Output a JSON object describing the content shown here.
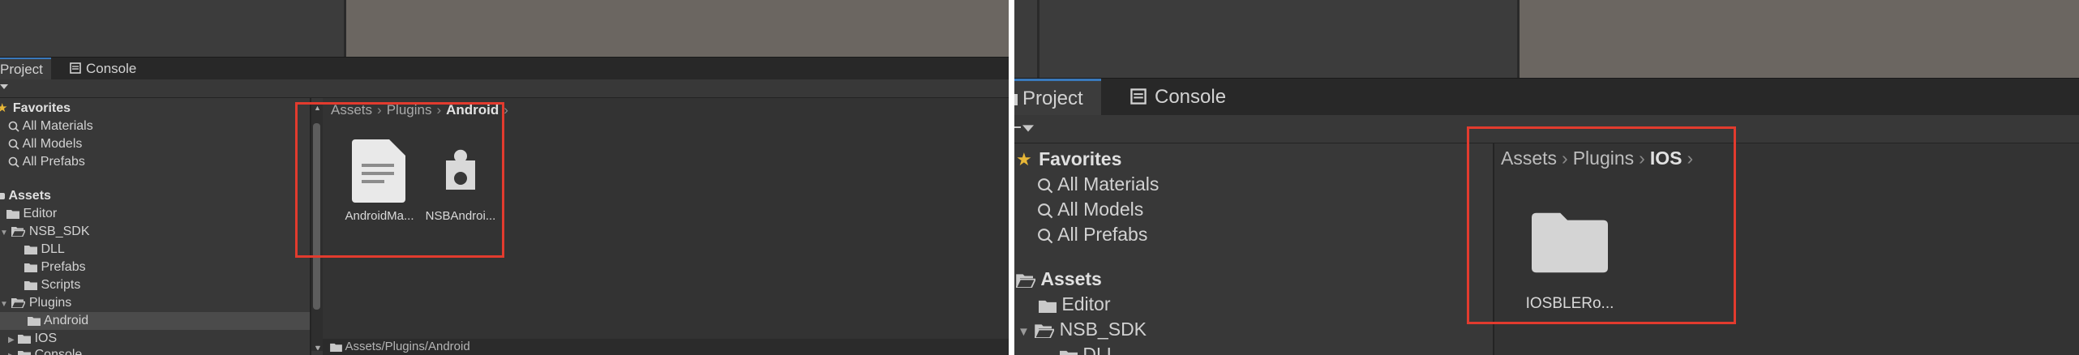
{
  "colors": {
    "highlight_box": "#e23b2e",
    "active_tab_accent": "#3a79bb",
    "panel_bg": "#383838"
  },
  "left": {
    "tabs": [
      {
        "label": "Project",
        "icon": "project-icon"
      },
      {
        "label": "Console",
        "icon": "console-icon"
      }
    ],
    "favorites": {
      "label": "Favorites",
      "items": [
        "All Materials",
        "All Models",
        "All Prefabs"
      ]
    },
    "assets": {
      "label": "Assets",
      "items": [
        "Editor",
        "NSB_SDK",
        "DLL",
        "Prefabs",
        "Scripts",
        "Plugins",
        "Android",
        "IOS",
        "Console"
      ]
    },
    "breadcrumb": [
      "Assets",
      "Plugins",
      "Android"
    ],
    "files": [
      {
        "name": "AndroidMa...",
        "icon": "document-icon"
      },
      {
        "name": "NSBAndroi...",
        "icon": "plugin-icon"
      }
    ],
    "status_path": "Assets/Plugins/Android"
  },
  "right": {
    "tabs": [
      {
        "label": "Project",
        "icon": "project-icon"
      },
      {
        "label": "Console",
        "icon": "console-icon"
      }
    ],
    "favorites": {
      "label": "Favorites",
      "items": [
        "All Materials",
        "All Models",
        "All Prefabs"
      ]
    },
    "assets": {
      "label": "Assets",
      "items": [
        "Editor",
        "NSB_SDK",
        "DLL"
      ]
    },
    "breadcrumb": [
      "Assets",
      "Plugins",
      "IOS"
    ],
    "files": [
      {
        "name": "IOSBLERo...",
        "icon": "folder-icon"
      }
    ]
  }
}
